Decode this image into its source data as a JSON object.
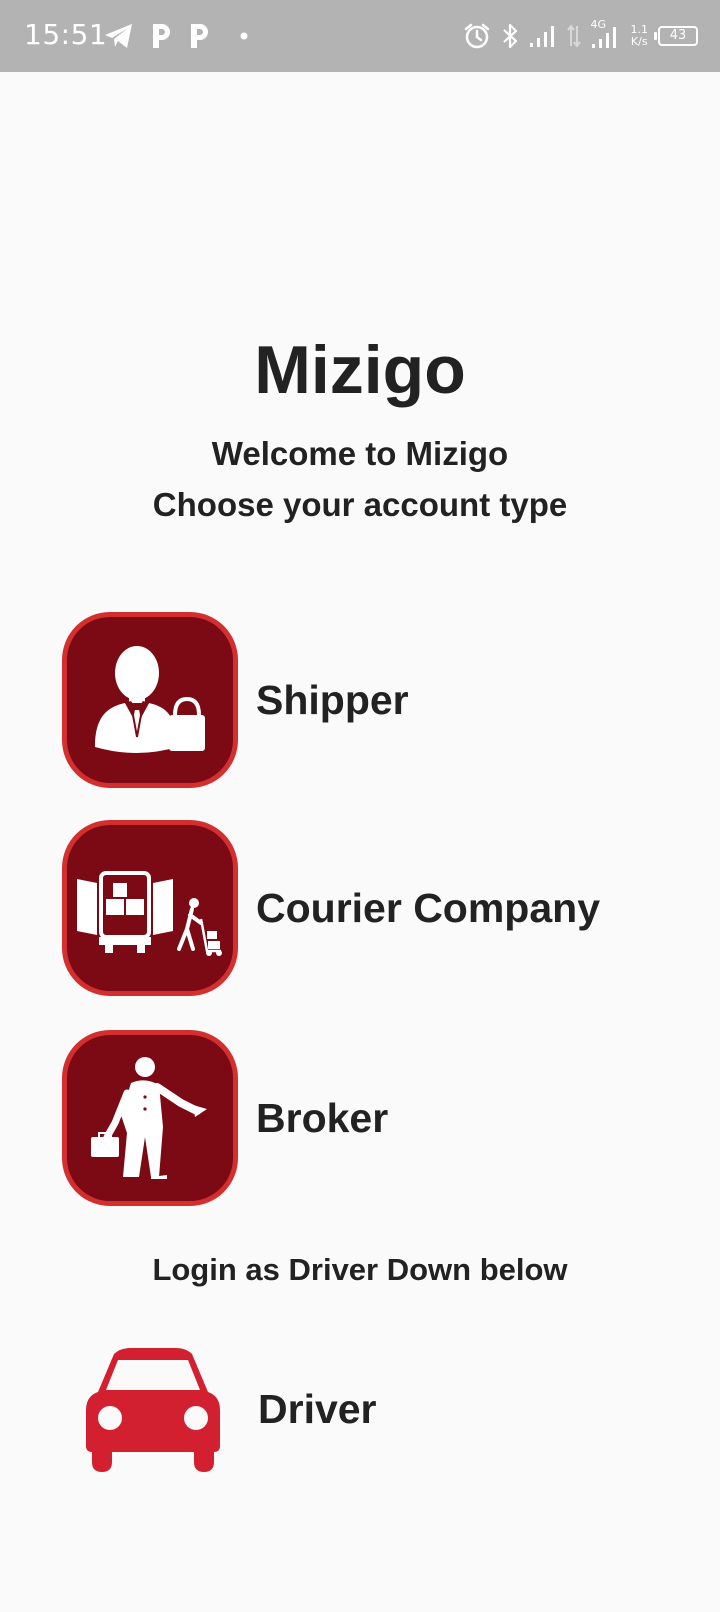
{
  "status_bar": {
    "time": "15:51",
    "net_speed_value": "1.1",
    "net_speed_unit": "K/s",
    "network_type": "4G",
    "battery": "43",
    "left_icons": [
      "telegram-icon",
      "p-app-icon",
      "p-app-icon",
      "dot-icon"
    ],
    "right_icons": [
      "alarm-icon",
      "bluetooth-icon",
      "signal-icon",
      "data-arrows-icon",
      "signal-4g-icon"
    ]
  },
  "app": {
    "title": "Mizigo",
    "welcome": "Welcome to Mizigo",
    "subtitle": "Choose your account type"
  },
  "account_types": [
    {
      "label": "Shipper",
      "icon": "shipper-icon"
    },
    {
      "label": "Courier Company",
      "icon": "courier-truck-icon"
    },
    {
      "label": "Broker",
      "icon": "broker-icon"
    }
  ],
  "driver_section": {
    "prompt": "Login as Driver Down below",
    "label": "Driver",
    "icon": "car-icon"
  },
  "colors": {
    "icon_bg": "#7b0a15",
    "icon_border": "#d32f2f",
    "car": "#d32030",
    "status_bar_bg": "#b3b3b3",
    "background": "#fafafa",
    "text": "#222222"
  }
}
